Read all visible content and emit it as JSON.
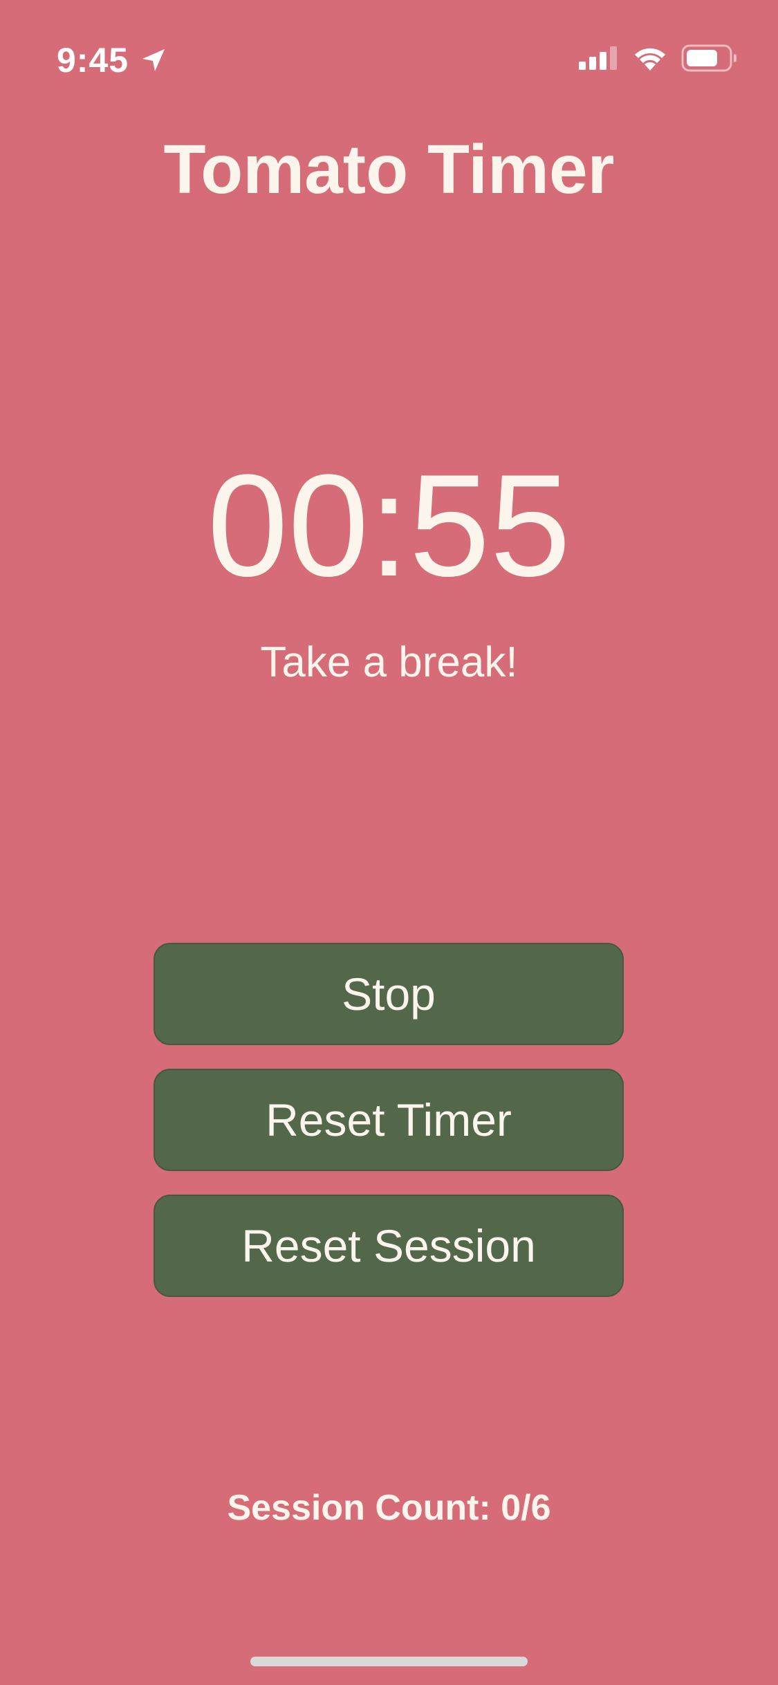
{
  "status_bar": {
    "time": "9:45",
    "icons": [
      "location-arrow-icon",
      "cellular-signal-icon",
      "wifi-icon",
      "battery-icon"
    ]
  },
  "app": {
    "title": "Tomato Timer"
  },
  "timer": {
    "display": "00:55",
    "message": "Take a break!"
  },
  "buttons": {
    "stop": "Stop",
    "reset_timer": "Reset Timer",
    "reset_session": "Reset Session"
  },
  "session": {
    "count_text": "Session Count: 0/6"
  },
  "colors": {
    "background": "#d66c77",
    "button": "#53674b",
    "text": "#fbf5ec"
  }
}
